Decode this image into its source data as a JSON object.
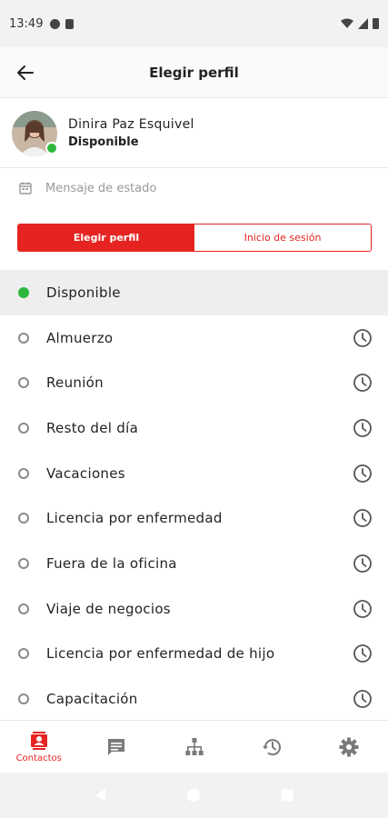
{
  "status_bar": {
    "time": "13:49",
    "icons_left": [
      "data-saver-icon",
      "sd-card-icon"
    ],
    "icons_right": [
      "wifi-icon",
      "signal-icon",
      "battery-icon"
    ]
  },
  "header": {
    "title": "Elegir perfil",
    "back_icon": "arrow-left-icon"
  },
  "profile": {
    "name": "Dinira Paz Esquivel",
    "status": "Disponible",
    "status_color": "#2db83d"
  },
  "message": {
    "placeholder": "Mensaje de estado",
    "value": ""
  },
  "tabs": [
    {
      "label": "Elegir perfil",
      "active": true
    },
    {
      "label": "Inicio de sesión",
      "active": false
    }
  ],
  "statuses": [
    {
      "label": "Disponible",
      "selected": true,
      "timer": false
    },
    {
      "label": "Almuerzo",
      "selected": false,
      "timer": true
    },
    {
      "label": "Reunión",
      "selected": false,
      "timer": true
    },
    {
      "label": "Resto del día",
      "selected": false,
      "timer": true
    },
    {
      "label": "Vacaciones",
      "selected": false,
      "timer": true
    },
    {
      "label": "Licencia por enfermedad",
      "selected": false,
      "timer": true
    },
    {
      "label": "Fuera de la oficina",
      "selected": false,
      "timer": true
    },
    {
      "label": "Viaje de negocios",
      "selected": false,
      "timer": true
    },
    {
      "label": "Licencia por enfermedad de hijo",
      "selected": false,
      "timer": true
    },
    {
      "label": "Capacitación",
      "selected": false,
      "timer": true
    }
  ],
  "bottom_nav": [
    {
      "label": "Contactos",
      "icon": "contacts-icon",
      "active": true
    },
    {
      "label": "",
      "icon": "chat-icon",
      "active": false
    },
    {
      "label": "",
      "icon": "org-chart-icon",
      "active": false
    },
    {
      "label": "",
      "icon": "history-icon",
      "active": false
    },
    {
      "label": "",
      "icon": "settings-icon",
      "active": false
    }
  ],
  "colors": {
    "accent": "#e52421",
    "available": "#2db83d",
    "inactive_icon": "#8a8a8a"
  }
}
